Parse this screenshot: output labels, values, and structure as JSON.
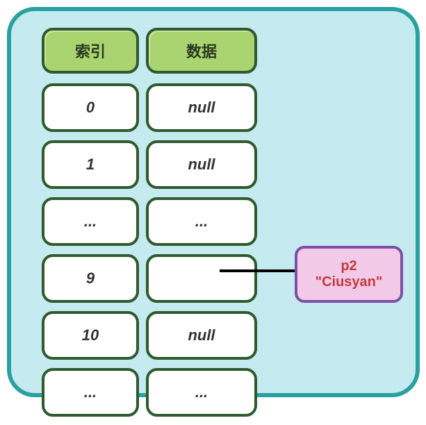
{
  "headers": {
    "index": "索引",
    "data": "数据"
  },
  "rows": [
    {
      "index": "0",
      "data": "null"
    },
    {
      "index": "1",
      "data": "null"
    },
    {
      "index": "...",
      "data": "..."
    },
    {
      "index": "9",
      "data": ""
    },
    {
      "index": "10",
      "data": "null"
    },
    {
      "index": "...",
      "data": "..."
    }
  ],
  "pointer": {
    "name": "p2",
    "value": "\"Ciusyan\""
  },
  "chart_data": {
    "type": "table",
    "title": "",
    "columns": [
      "索引",
      "数据"
    ],
    "rows": [
      [
        "0",
        "null"
      ],
      [
        "1",
        "null"
      ],
      [
        "...",
        "..."
      ],
      [
        "9",
        "→ p2 \"Ciusyan\""
      ],
      [
        "10",
        "null"
      ],
      [
        "...",
        "..."
      ]
    ],
    "annotations": [
      "Index 9 points to object p2 with value \"Ciusyan\""
    ]
  }
}
